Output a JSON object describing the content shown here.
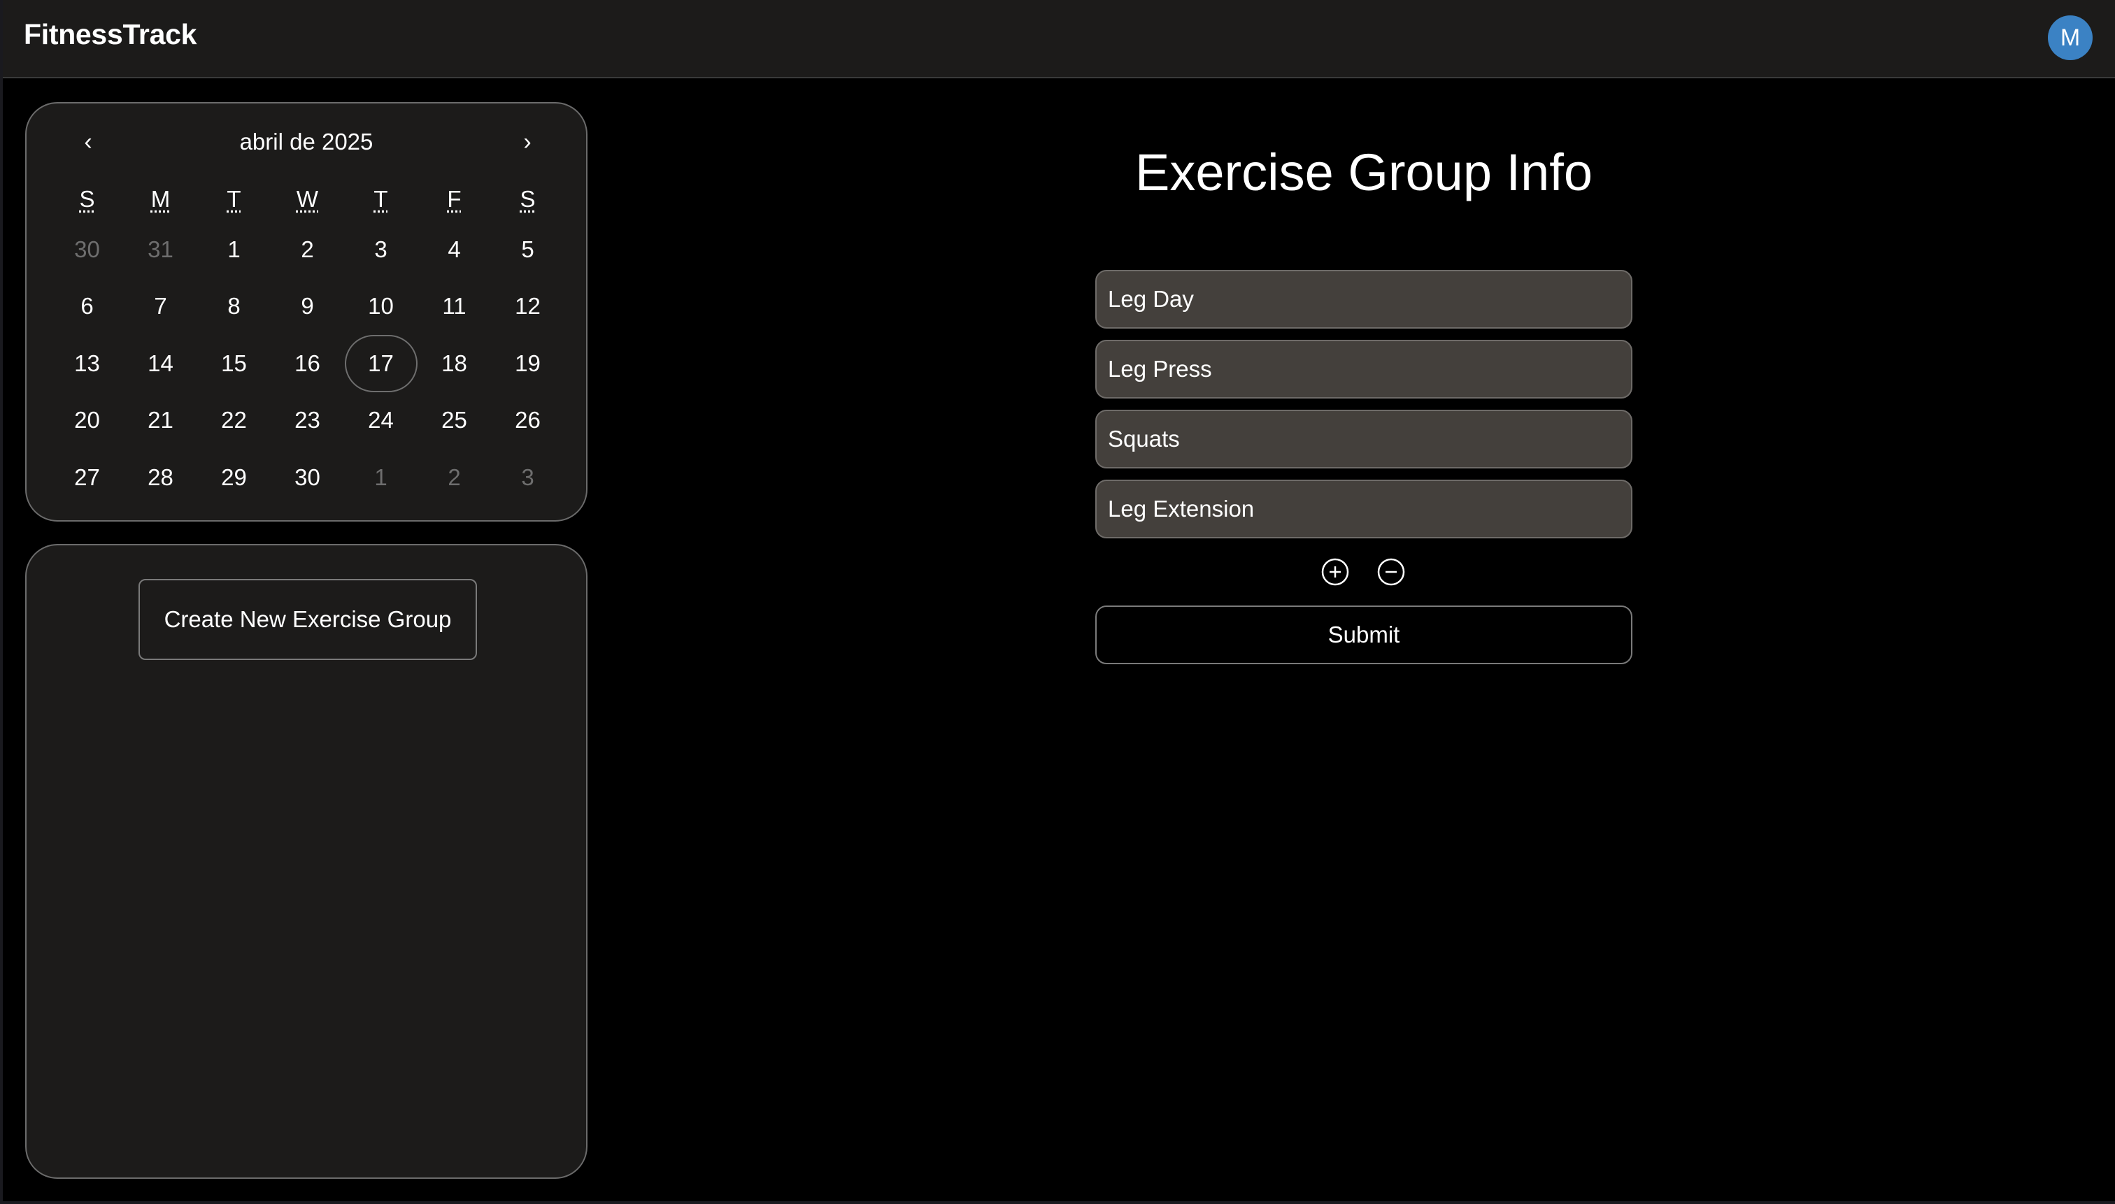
{
  "app": {
    "brand": "FitnessTrack",
    "avatar_initial": "M",
    "avatar_color": "#3b82c4"
  },
  "calendar": {
    "month_title": "abril de 2025",
    "prev_label": "‹",
    "next_label": "›",
    "weekdays": [
      "S",
      "M",
      "T",
      "W",
      "T",
      "F",
      "S"
    ],
    "days": [
      {
        "label": "30",
        "muted": true
      },
      {
        "label": "31",
        "muted": true
      },
      {
        "label": "1"
      },
      {
        "label": "2"
      },
      {
        "label": "3"
      },
      {
        "label": "4"
      },
      {
        "label": "5"
      },
      {
        "label": "6"
      },
      {
        "label": "7"
      },
      {
        "label": "8"
      },
      {
        "label": "9"
      },
      {
        "label": "10"
      },
      {
        "label": "11"
      },
      {
        "label": "12"
      },
      {
        "label": "13"
      },
      {
        "label": "14"
      },
      {
        "label": "15"
      },
      {
        "label": "16"
      },
      {
        "label": "17",
        "today": true
      },
      {
        "label": "18"
      },
      {
        "label": "19"
      },
      {
        "label": "20"
      },
      {
        "label": "21"
      },
      {
        "label": "22"
      },
      {
        "label": "23"
      },
      {
        "label": "24"
      },
      {
        "label": "25"
      },
      {
        "label": "26"
      },
      {
        "label": "27"
      },
      {
        "label": "28"
      },
      {
        "label": "29"
      },
      {
        "label": "30"
      },
      {
        "label": "1",
        "muted": true
      },
      {
        "label": "2",
        "muted": true
      },
      {
        "label": "3",
        "muted": true
      }
    ]
  },
  "groups_panel": {
    "create_label": "Create New Exercise Group"
  },
  "form": {
    "title": "Exercise Group Info",
    "fields": [
      {
        "value": "Leg Day"
      },
      {
        "value": "Leg Press"
      },
      {
        "value": "Squats"
      },
      {
        "value": "Leg Extension"
      }
    ],
    "add_icon": "plus-circle-icon",
    "remove_icon": "minus-circle-icon",
    "submit_label": "Submit"
  }
}
